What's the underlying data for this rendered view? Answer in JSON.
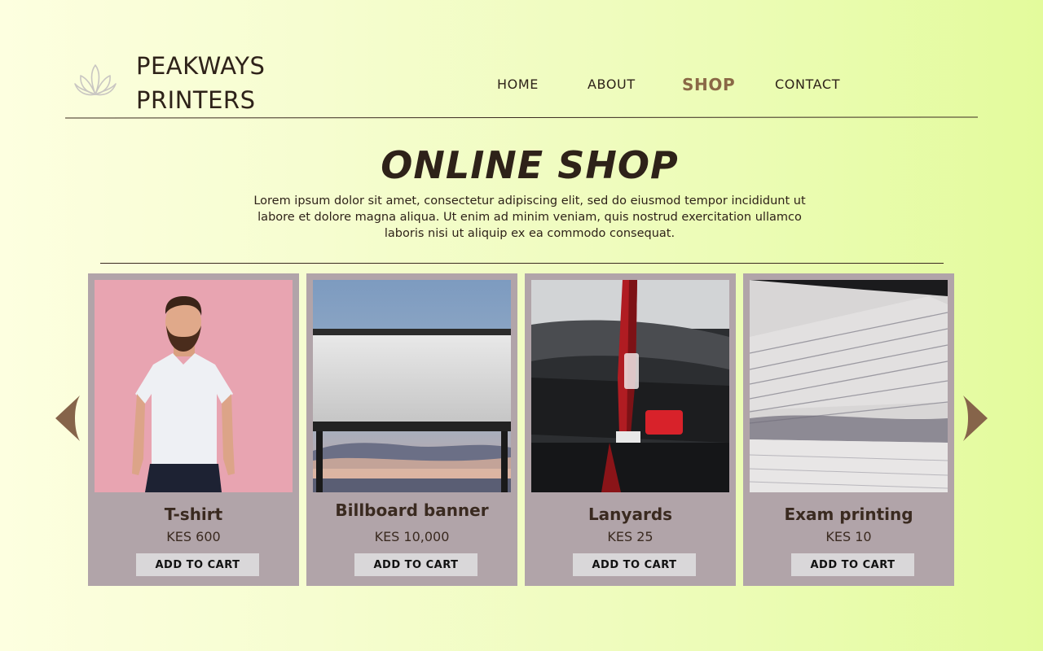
{
  "brand": {
    "line1": "PEAKWAYS",
    "line2": "PRINTERS",
    "logo_icon": "lotus-icon"
  },
  "nav": {
    "items": [
      {
        "label": "HOME"
      },
      {
        "label": "ABOUT"
      },
      {
        "label": "SHOP",
        "active": true
      },
      {
        "label": "CONTACT"
      }
    ]
  },
  "hero": {
    "title": "ONLINE SHOP",
    "text": "Lorem ipsum dolor sit amet, consectetur adipiscing elit, sed do eiusmod tempor incididunt ut labore et dolore magna aliqua. Ut enim ad minim veniam, quis nostrud exercitation ullamco laboris nisi ut aliquip ex ea commodo consequat."
  },
  "carousel": {
    "prev_icon": "chevron-left-icon",
    "next_icon": "chevron-right-icon",
    "products": [
      {
        "name": "T-shirt",
        "price": "KES 600",
        "button": "ADD TO CART",
        "image": "man-in-white-tshirt-photo"
      },
      {
        "name": "Billboard banner",
        "price": "KES 10,000",
        "button": "ADD TO CART",
        "image": "billboard-photo"
      },
      {
        "name": "Lanyards",
        "price": "KES 25",
        "button": "ADD TO CART",
        "image": "red-lanyard-photo"
      },
      {
        "name": "Exam printing",
        "price": "KES 10",
        "button": "ADD TO CART",
        "image": "paper-stack-photo"
      }
    ]
  },
  "colors": {
    "accent": "#8a6846",
    "text": "#2e2219",
    "card": "#b1a4a9",
    "button": "#d9d7d9"
  }
}
